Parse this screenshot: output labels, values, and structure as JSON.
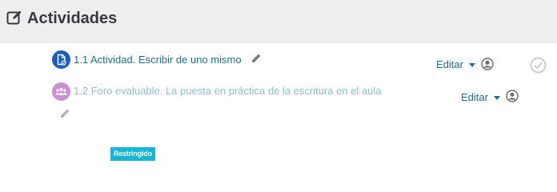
{
  "section": {
    "title": "Actividades",
    "icon": "edit-square-icon"
  },
  "activities": [
    {
      "number": "1.1",
      "name": "Actividad. Escribir de uno mismo",
      "icon": "assignment-icon",
      "icon_color": "#1a5ebd",
      "link_color": "#1f6f89",
      "edit_label": "Editar",
      "completion": "completion-check-icon"
    },
    {
      "number": "1.2",
      "name": "Foro evaluable. La puesta en práctica de la escritura en el aula",
      "icon": "forum-icon",
      "icon_color": "#c990d6",
      "link_color": "#8fc0cf",
      "edit_label": "Editar"
    }
  ],
  "restriction_badge": "Restringido",
  "colors": {
    "header_bg": "#eeeeee",
    "badge_bg": "#17b5d3",
    "edit_text": "#1f6f89"
  }
}
